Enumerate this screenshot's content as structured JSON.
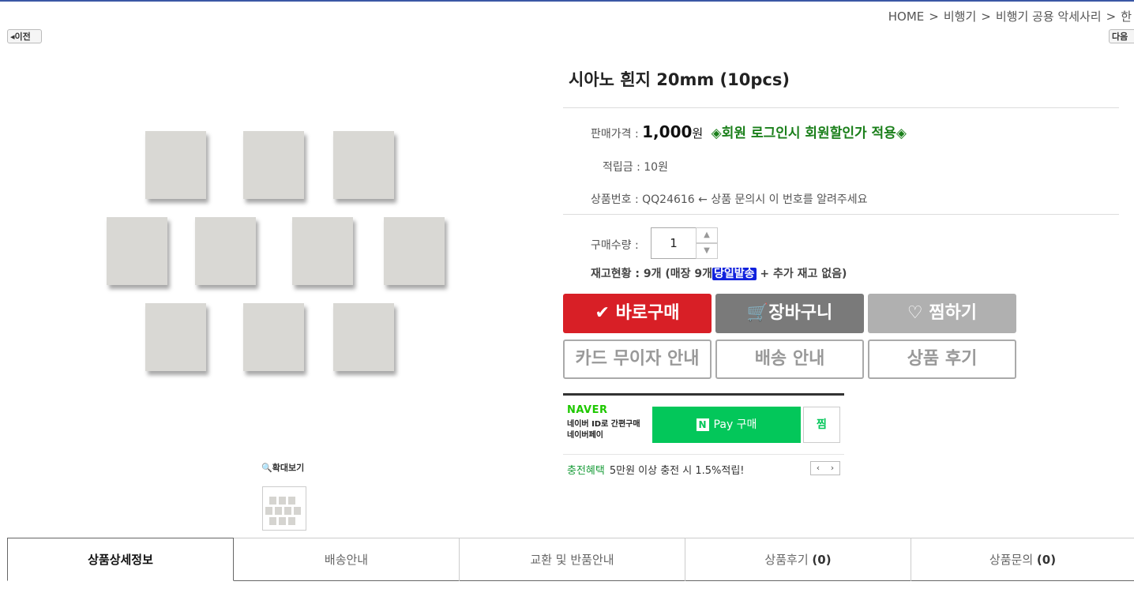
{
  "breadcrumb": {
    "items": [
      "HOME",
      "비행기",
      "비행기 공용 악세사리",
      "한"
    ],
    "separator": ">"
  },
  "nav": {
    "prev_label": "이전",
    "next_label": "다음"
  },
  "product": {
    "title": "시아노 흰지 20mm (10pcs)",
    "price_label": "판매가격 :",
    "price_value": "1,000",
    "price_unit": "원",
    "promo": "◈회원 로그인시 회원할인가 적용◈",
    "points_label": "적립금 :",
    "points_value": "10원",
    "code_label": "상품번호 :",
    "code_value": "QQ24616 ← 상품 문의시 이 번호를 알려주세요",
    "qty_label": "구매수량 :",
    "qty_value": "1",
    "stock_prefix": "재고현황 : 9개 (매장 9개",
    "stock_badge": "당일발송",
    "stock_suffix": " + 추가 재고 없음)"
  },
  "gallery": {
    "zoom_label": "확대보기"
  },
  "buttons": {
    "buy": "바로구매",
    "cart": "장바구니",
    "wish": "찜하기",
    "card": "카드 무이자 안내",
    "shipping": "배송 안내",
    "review": "상품 후기"
  },
  "npay": {
    "brand": "NAVER",
    "desc_line1": "네이버 ID로 간편구매",
    "desc_line2": "네이버페이",
    "pay_label": "Pay 구매",
    "zzim_label": "찜",
    "benefit_tag": "충전혜택",
    "benefit_text": "5만원 이상 충전 시 1.5%적립!"
  },
  "tabs": [
    {
      "label": "상품상세정보",
      "count": ""
    },
    {
      "label": "배송안내",
      "count": ""
    },
    {
      "label": "교환 및 반품안내",
      "count": ""
    },
    {
      "label": "상품후기",
      "count": "(0)"
    },
    {
      "label": "상품문의",
      "count": "(0)"
    }
  ],
  "colors": {
    "buy_button": "#d81f26",
    "cart_button": "#7a7a7a",
    "wish_button": "#b0b0b0",
    "promo_text": "#1a7f1a",
    "naver_green": "#03c75a",
    "stock_badge": "#1122dd"
  }
}
